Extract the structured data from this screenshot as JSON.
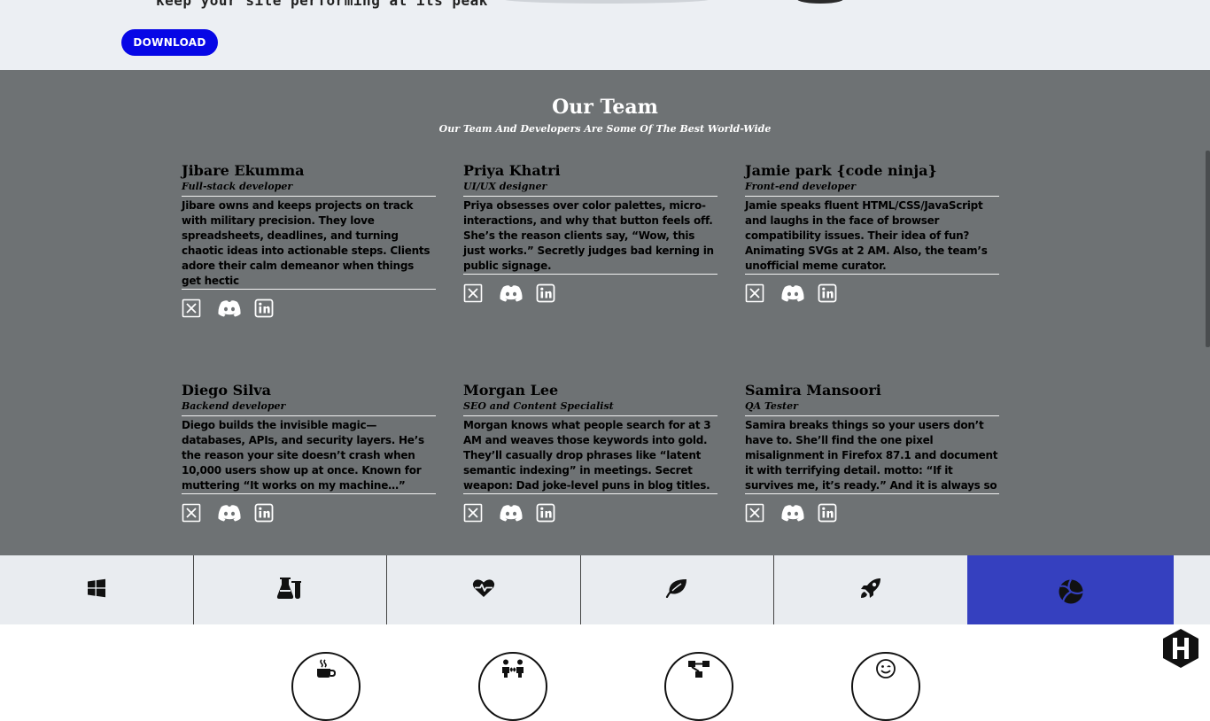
{
  "top": {
    "tagline": "keep your site performing at its peak",
    "download_label": "DOWNLOAD"
  },
  "team": {
    "title": "Our Team",
    "subtitle": "Our Team And Developers Are Some Of The Best World-Wide",
    "members": [
      {
        "name": "Jibare Ekumma",
        "role": "Full-stack developer",
        "bio": "Jibare owns and keeps projects on track with military precision. They love spreadsheets, deadlines, and turning chaotic ideas into actionable steps. Clients adore their calm demeanor when things get hectic"
      },
      {
        "name": "Priya Khatri",
        "role": "UI/UX designer",
        "bio": "Priya obsesses over color palettes, micro-interactions, and why that button feels off. She’s the reason clients say, “Wow, this just works.” Secretly judges bad kerning in public signage."
      },
      {
        "name": "Jamie park {code ninja}",
        "role": "Front-end developer",
        "bio": "Jamie speaks fluent HTML/CSS/JavaScript and laughs in the face of browser compatibility issues. Their idea of fun? Animating SVGs at 2 AM. Also, the team’s unofficial meme curator."
      },
      {
        "name": "Diego Silva",
        "role": "Backend developer",
        "bio": "Diego builds the invisible magic—databases, APIs, and security layers. He’s the reason your site doesn’t crash when 10,000 users show up at once. Known for muttering “It works on my machine…”"
      },
      {
        "name": "Morgan Lee",
        "role": "SEO and Content Specialist",
        "bio": "Morgan knows what people search for at 3 AM and weaves those keywords into gold. They’ll casually drop phrases like “latent semantic indexing” in meetings. Secret weapon: Dad joke-level puns in blog titles."
      },
      {
        "name": "Samira Mansoori",
        "role": "QA Tester",
        "bio": "Samira breaks things so your users don’t have to. She’ll find the one pixel misalignment in Firefox 87.1 and document it with terrifying detail. motto: “If it survives me, it’s ready.” And it is always so"
      }
    ]
  },
  "tabs": [
    {
      "icon": "windows-icon"
    },
    {
      "icon": "flask-icon"
    },
    {
      "icon": "heartbeat-icon"
    },
    {
      "icon": "leaf-icon"
    },
    {
      "icon": "rocket-icon"
    },
    {
      "icon": "volleyball-icon",
      "active": true
    }
  ],
  "features": [
    {
      "icon": "coffee-icon"
    },
    {
      "icon": "people-exchange-icon"
    },
    {
      "icon": "network-icon"
    },
    {
      "icon": "smile-icon"
    }
  ],
  "colors": {
    "accent": "#0707e6",
    "team_bg": "#6e7274",
    "active_tab": "#3540bf",
    "tab_bar_bg": "#e9ecf0"
  }
}
